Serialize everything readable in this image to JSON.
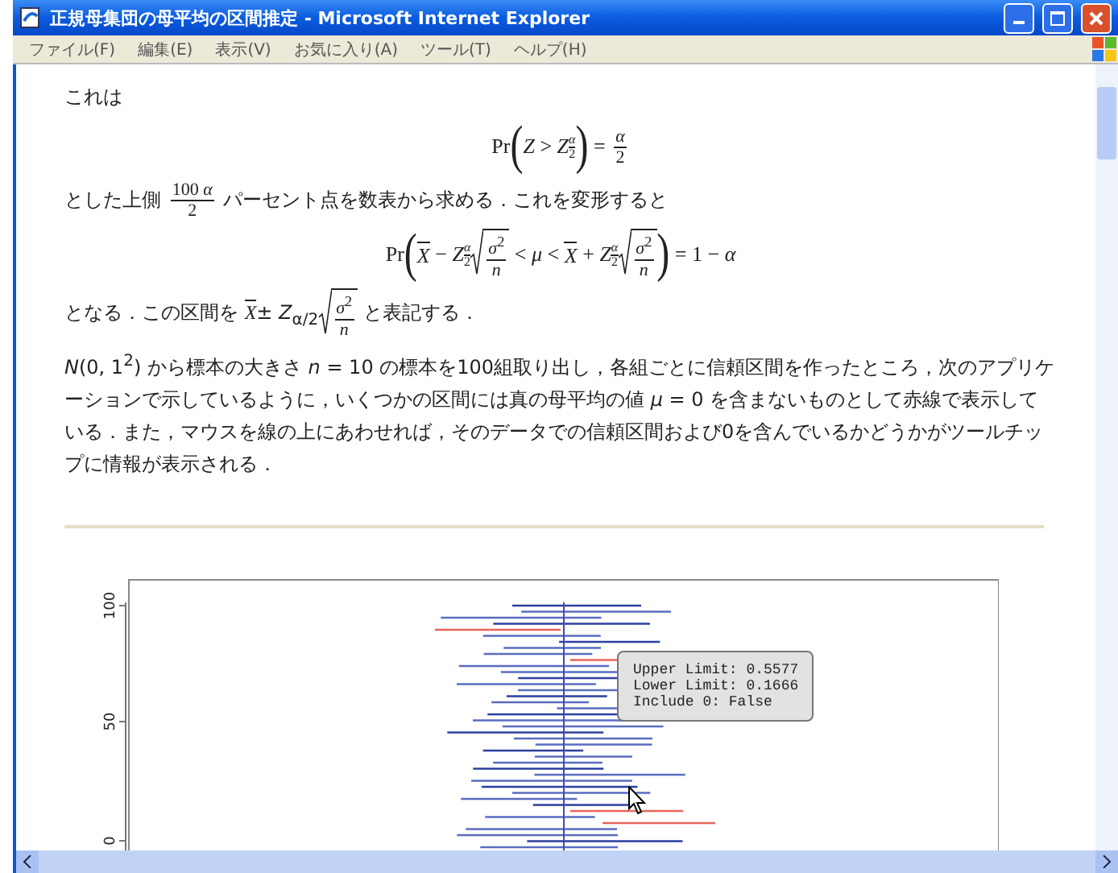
{
  "window": {
    "title": "正規母集団の母平均の区間推定 - Microsoft Internet Explorer"
  },
  "menu": [
    "ファイル(F)",
    "編集(E)",
    "表示(V)",
    "お気に入り(A)",
    "ツール(T)",
    "ヘルプ(H)"
  ],
  "content": [
    {
      "kind": "paragraph",
      "tokens": [
        {
          "kind": "text",
          "text": "これは"
        }
      ]
    },
    {
      "kind": "formula",
      "tokens": [
        {
          "kind": "text",
          "text": "Pr"
        },
        {
          "kind": "paren",
          "text": "("
        },
        {
          "kind": "text",
          "text": "*Z* > *Z*"
        },
        {
          "kind": "subfrac",
          "num": "*α*",
          "den": "2"
        },
        {
          "kind": "paren",
          "text": ")"
        },
        {
          "kind": "text",
          "text": " = "
        },
        {
          "kind": "frac",
          "num": "*α*",
          "den": "2"
        }
      ]
    },
    {
      "kind": "paragraph",
      "tokens": [
        {
          "kind": "text",
          "text": "とした上側 "
        },
        {
          "kind": "frac",
          "num": "100 *α*",
          "den": "2"
        },
        {
          "kind": "text",
          "text": " パーセント点を数表から求める．これを変形すると"
        }
      ]
    },
    {
      "kind": "formula",
      "tokens": [
        {
          "kind": "text",
          "text": "Pr"
        },
        {
          "kind": "paren",
          "text": "("
        },
        {
          "kind": "bar",
          "text": "*X*"
        },
        {
          "kind": "text",
          "text": " − *Z*"
        },
        {
          "kind": "subfrac",
          "num": "*α*",
          "den": "2"
        },
        {
          "kind": "sqrt",
          "num": "*σ*$^{2}$",
          "den": "*n*"
        },
        {
          "kind": "text",
          "text": " < *μ* < "
        },
        {
          "kind": "bar",
          "text": "*X*"
        },
        {
          "kind": "text",
          "text": " + *Z*"
        },
        {
          "kind": "subfrac",
          "num": "*α*",
          "den": "2"
        },
        {
          "kind": "sqrt",
          "num": "*σ*$^{2}$",
          "den": "*n*"
        },
        {
          "kind": "paren",
          "text": ")"
        },
        {
          "kind": "text",
          "text": " = 1 − *α*"
        }
      ]
    },
    {
      "kind": "paragraph",
      "tokens": [
        {
          "kind": "text",
          "text": "となる．この区間を "
        },
        {
          "kind": "bar",
          "text": "*X*"
        },
        {
          "kind": "text",
          "text": "± *Z*$_{α/2}$"
        },
        {
          "kind": "sqrt",
          "num": "*σ*$^{2}$",
          "den": "*n*"
        },
        {
          "kind": "text",
          "text": " と表記する．"
        }
      ]
    },
    {
      "kind": "paragraph",
      "tokens": [
        {
          "kind": "text",
          "text": "*N*(0, 1$^{2}$) から標本の大きさ *n* = 10 の標本を100組取り出し，各組ごとに信頼区間を作ったところ，次のアプリケーションで示しているように，いくつかの区間には真の母平均の値 *μ* = 0 を含まないものとして赤線で表示している．また，マウスを線の上にあわせれば，そのデータでの信頼区間および0を含んでいるかどうかがツールチップに情報が表示される．"
        }
      ]
    }
  ],
  "plot": {
    "y_ticks": [
      "100",
      "50",
      "0"
    ],
    "tooltip": [
      "Upper Limit: 0.5577",
      "Lower Limit: 0.1666",
      "Include 0: False"
    ]
  }
}
